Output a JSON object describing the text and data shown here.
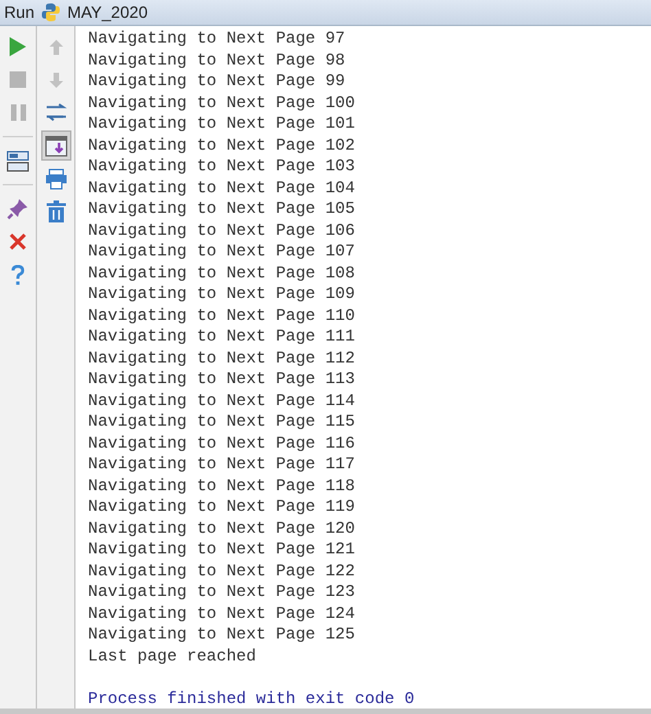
{
  "title_bar": {
    "label": "Run",
    "config_name": "MAY_2020"
  },
  "left_toolbar": [
    {
      "kind": "run"
    },
    {
      "kind": "stop",
      "disabled": true
    },
    {
      "kind": "pause",
      "disabled": true
    },
    {
      "kind": "separator"
    },
    {
      "kind": "layout"
    },
    {
      "kind": "separator"
    },
    {
      "kind": "pin"
    },
    {
      "kind": "close"
    },
    {
      "kind": "help"
    }
  ],
  "console_toolbar": [
    {
      "kind": "up",
      "disabled": true,
      "selected": false
    },
    {
      "kind": "down",
      "disabled": true,
      "selected": false
    },
    {
      "kind": "wrap",
      "selected": false
    },
    {
      "kind": "scroll-end",
      "selected": true
    },
    {
      "kind": "print",
      "selected": false
    },
    {
      "kind": "trash",
      "selected": false
    }
  ],
  "console": {
    "lines": [
      "Navigating to Next Page 97",
      "Navigating to Next Page 98",
      "Navigating to Next Page 99",
      "Navigating to Next Page 100",
      "Navigating to Next Page 101",
      "Navigating to Next Page 102",
      "Navigating to Next Page 103",
      "Navigating to Next Page 104",
      "Navigating to Next Page 105",
      "Navigating to Next Page 106",
      "Navigating to Next Page 107",
      "Navigating to Next Page 108",
      "Navigating to Next Page 109",
      "Navigating to Next Page 110",
      "Navigating to Next Page 111",
      "Navigating to Next Page 112",
      "Navigating to Next Page 113",
      "Navigating to Next Page 114",
      "Navigating to Next Page 115",
      "Navigating to Next Page 116",
      "Navigating to Next Page 117",
      "Navigating to Next Page 118",
      "Navigating to Next Page 119",
      "Navigating to Next Page 120",
      "Navigating to Next Page 121",
      "Navigating to Next Page 122",
      "Navigating to Next Page 123",
      "Navigating to Next Page 124",
      "Navigating to Next Page 125",
      "Last page reached"
    ],
    "exit_message": "Process finished with exit code 0"
  }
}
